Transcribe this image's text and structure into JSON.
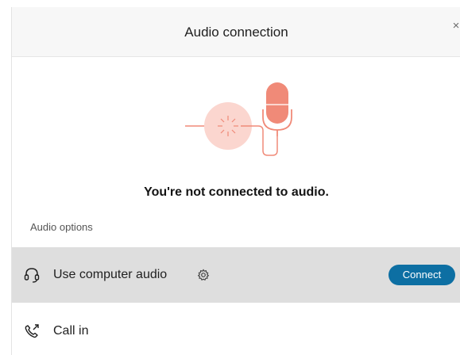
{
  "dialog": {
    "title": "Audio connection",
    "close_glyph": "×",
    "status_text": "You're not connected to audio.",
    "section_label": "Audio options"
  },
  "options": [
    {
      "label": "Use computer audio",
      "icon": "headset-icon",
      "has_settings": true,
      "action_label": "Connect",
      "selected": true
    },
    {
      "label": "Call in",
      "icon": "phone-call-icon",
      "selected": false
    }
  ],
  "colors": {
    "accent": "#0d6fa3",
    "illustration": "#f08a78",
    "illustration_light": "#fbd6cf",
    "selected_row": "#dedede",
    "header_bg": "#f7f7f7"
  }
}
